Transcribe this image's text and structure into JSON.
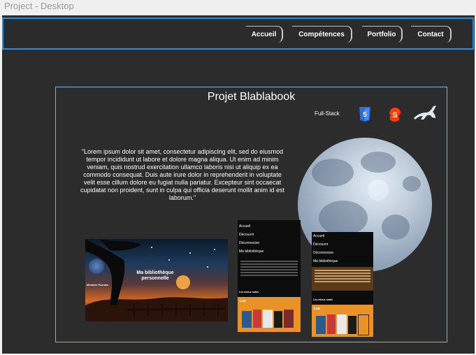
{
  "frame_title": "Project - Desktop",
  "nav": {
    "items": [
      {
        "label": "Accueil"
      },
      {
        "label": "Compétences"
      },
      {
        "label": "Portfolio"
      },
      {
        "label": "Contact"
      }
    ]
  },
  "project": {
    "title": "Projet Blablabook",
    "stack_label": "Full-Stack",
    "tech_icons": [
      "html5-icon",
      "svelte-icon",
      "express-icon"
    ],
    "description": "\"Lorem ipsum dolor sit amet, consectetur adipiscing elit, sed do eiusmod tempor incididunt ut labore et dolore magna aliqua. Ut enim ad minim veniam, quis nostrud exercitation ullamco laboris nisi ut aliquip ex ea commodo consequat. Duis aute irure dolor in reprehenderit in voluptate velit esse cillum dolore eu fugiat nulla pariatur. Excepteur sint occaecat cupidatat non proident, sunt in culpa qui officia deserunt mollit anim id est laborum.\"",
    "desktop_preview": {
      "headline": "Ma bibliothèque personnelle",
      "member_label": "Membre Pseudo"
    },
    "mobile_preview": {
      "menu": [
        "Accueil",
        "Découvrir",
        "Déconnexion",
        "Ma bibliothèque"
      ],
      "section_label": "Les mieux notés",
      "tab_label": "Lus"
    }
  },
  "colors": {
    "header_border": "#1e8fe8",
    "project_border": "#78b6e0",
    "background": "#2c2c2c",
    "accent_orange": "#e89228"
  }
}
